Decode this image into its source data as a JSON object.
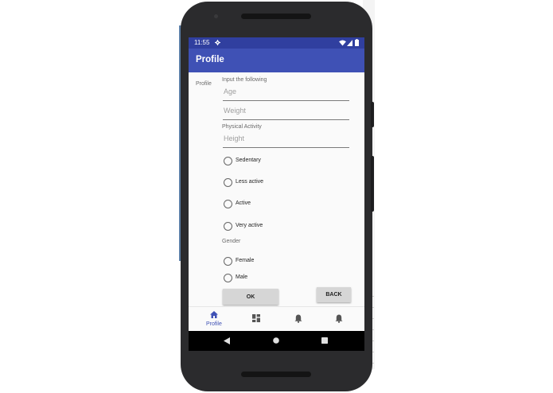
{
  "status_bar": {
    "time": "11:55",
    "settings_icon": "gear-icon",
    "wifi_icon": "wifi-icon",
    "signal_icon": "signal-icon",
    "battery_icon": "battery-icon"
  },
  "app_bar": {
    "title": "Profile"
  },
  "form": {
    "side_label": "Profile",
    "input_heading": "Input the following",
    "age_placeholder": "Age",
    "weight_placeholder": "Weight",
    "activity_heading": "Physical Activity",
    "height_placeholder": "Height",
    "activity_options": [
      "Sedentary",
      "Less active",
      "Active",
      "Very active"
    ],
    "gender_heading": "Gender",
    "gender_options": [
      "Female",
      "Male"
    ],
    "ok_label": "OK",
    "back_label": "BACK"
  },
  "bottom_nav": {
    "items": [
      {
        "label": "Profile",
        "icon": "home-icon",
        "active": true
      },
      {
        "label": "",
        "icon": "dashboard-icon",
        "active": false
      },
      {
        "label": "",
        "icon": "bell-icon",
        "active": false
      },
      {
        "label": "",
        "icon": "bell-icon",
        "active": false
      }
    ]
  },
  "colors": {
    "primary": "#3f51b5",
    "primary_dark": "#303f9f",
    "background": "#fafafa",
    "button": "#d6d6d6"
  }
}
